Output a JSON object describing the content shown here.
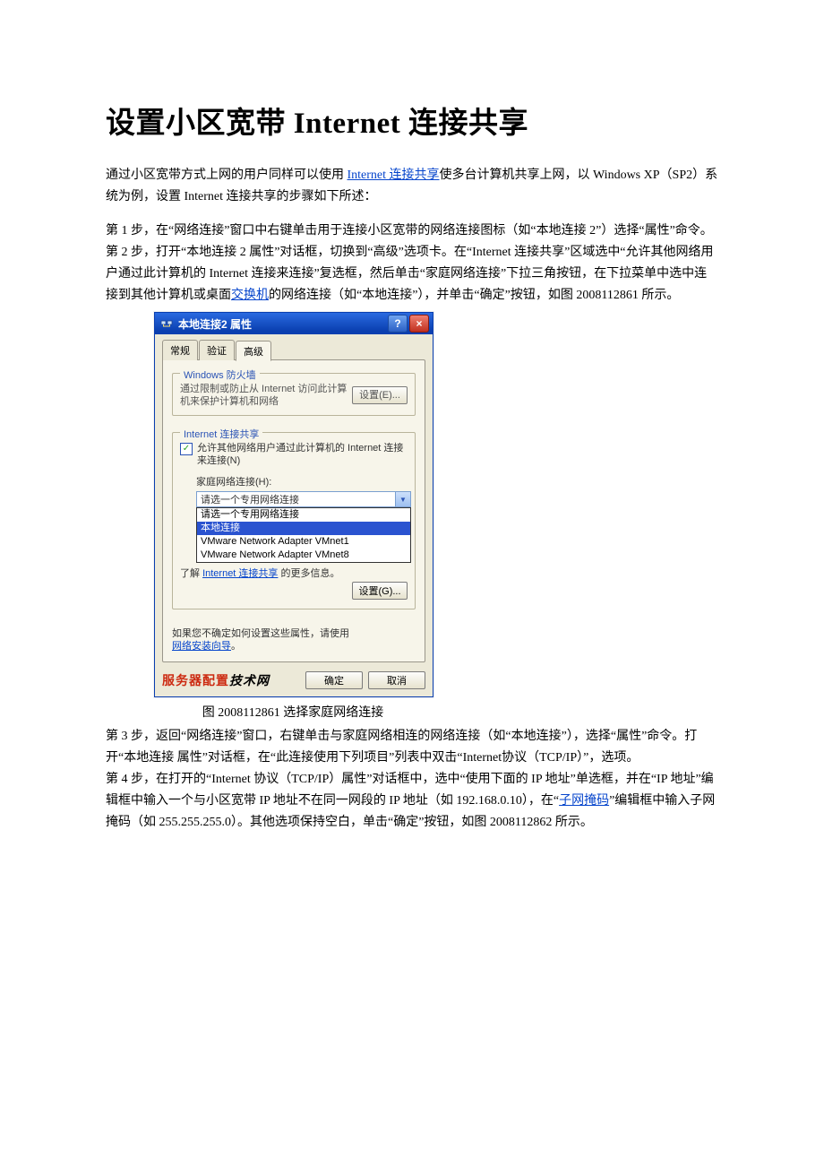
{
  "title": "设置小区宽带 Internet 连接共享",
  "intro": {
    "pre": "通过小区宽带方式上网的用户同样可以使用 ",
    "link": "Internet 连接共享",
    "post": "使多台计算机共享上网，以 Windows XP（SP2）系统为例，设置 Internet 连接共享的步骤如下所述："
  },
  "step1": "第 1 步，在“网络连接”窗口中右键单击用于连接小区宽带的网络连接图标（如“本地连接 2”）选择“属性”命令。",
  "step2": {
    "pre": "第 2 步，打开“本地连接 2 属性”对话框，切换到“高级”选项卡。在“Internet 连接共享”区域选中“允许其他网络用户通过此计算机的 Internet 连接来连接”复选框，然后单击“家庭网络连接”下拉三角按钮，在下拉菜单中选中连接到其他计算机或桌面",
    "link": "交换机",
    "post": "的网络连接（如“本地连接”），并单击“确定”按钮，如图 2008112861 所示。"
  },
  "dialog": {
    "title": "本地连接2 属性",
    "tabs": {
      "t1": "常规",
      "t2": "验证",
      "t3": "高级"
    },
    "firewall": {
      "legend": "Windows 防火墙",
      "text": "通过限制或防止从 Internet 访问此计算机来保护计算机和网络",
      "btn": "设置(E)..."
    },
    "ics": {
      "legend": "Internet 连接共享",
      "chk": "允许其他网络用户通过此计算机的 Internet 连接来连接(N)",
      "field": "家庭网络连接(H):",
      "combo": "请选一个专用网络连接",
      "opts": {
        "o1": "请选一个专用网络连接",
        "o2": "本地连接",
        "o3": "VMware Network Adapter VMnet1",
        "o4": "VMware Network Adapter VMnet8"
      },
      "learn_pre": "了解 ",
      "learn_link": "Internet 连接共享",
      "learn_post": " 的更多信息。",
      "btn": "设置(G)..."
    },
    "hint_pre": "如果您不确定如何设置这些属性，请使用",
    "hint_link": "网络安装向导",
    "brand1": "服务器配置",
    "brand2": "技术网",
    "ok": "确定",
    "cancel": "取消"
  },
  "caption": "图 2008112861 选择家庭网络连接",
  "step3": "第 3 步，返回“网络连接”窗口，右键单击与家庭网络相连的网络连接（如“本地连接”），选择“属性”命令。打开“本地连接 属性”对话框，在“此连接使用下列项目”列表中双击“Internet协议（TCP/IP）”，选项。",
  "step4": {
    "pre": "第 4 步，在打开的“Internet 协议（TCP/IP）属性”对话框中，选中“使用下面的 IP 地址”单选框，并在“IP 地址”编辑框中输入一个与小区宽带 IP 地址不在同一网段的 IP 地址（如 192.168.0.10），在“",
    "link": "子网掩码",
    "post": "”编辑框中输入子网掩码（如 255.255.255.0）。其他选项保持空白，单击“确定”按钮，如图 2008112862 所示。"
  }
}
